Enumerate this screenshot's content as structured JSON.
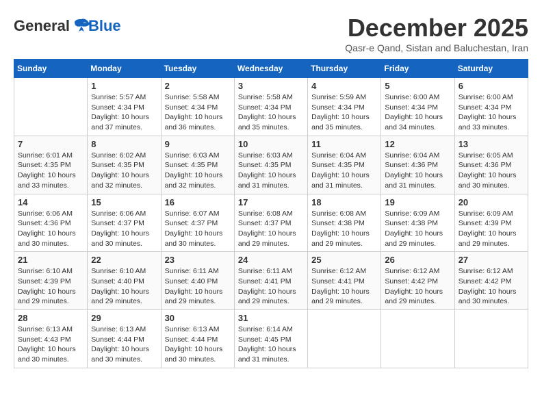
{
  "logo": {
    "general": "General",
    "blue": "Blue"
  },
  "header": {
    "title": "December 2025",
    "subtitle": "Qasr-e Qand, Sistan and Baluchestan, Iran"
  },
  "columns": [
    "Sunday",
    "Monday",
    "Tuesday",
    "Wednesday",
    "Thursday",
    "Friday",
    "Saturday"
  ],
  "weeks": [
    {
      "days": [
        {
          "num": "",
          "info": ""
        },
        {
          "num": "1",
          "info": "Sunrise: 5:57 AM\nSunset: 4:34 PM\nDaylight: 10 hours\nand 37 minutes."
        },
        {
          "num": "2",
          "info": "Sunrise: 5:58 AM\nSunset: 4:34 PM\nDaylight: 10 hours\nand 36 minutes."
        },
        {
          "num": "3",
          "info": "Sunrise: 5:58 AM\nSunset: 4:34 PM\nDaylight: 10 hours\nand 35 minutes."
        },
        {
          "num": "4",
          "info": "Sunrise: 5:59 AM\nSunset: 4:34 PM\nDaylight: 10 hours\nand 35 minutes."
        },
        {
          "num": "5",
          "info": "Sunrise: 6:00 AM\nSunset: 4:34 PM\nDaylight: 10 hours\nand 34 minutes."
        },
        {
          "num": "6",
          "info": "Sunrise: 6:00 AM\nSunset: 4:34 PM\nDaylight: 10 hours\nand 33 minutes."
        }
      ]
    },
    {
      "days": [
        {
          "num": "7",
          "info": "Sunrise: 6:01 AM\nSunset: 4:35 PM\nDaylight: 10 hours\nand 33 minutes."
        },
        {
          "num": "8",
          "info": "Sunrise: 6:02 AM\nSunset: 4:35 PM\nDaylight: 10 hours\nand 32 minutes."
        },
        {
          "num": "9",
          "info": "Sunrise: 6:03 AM\nSunset: 4:35 PM\nDaylight: 10 hours\nand 32 minutes."
        },
        {
          "num": "10",
          "info": "Sunrise: 6:03 AM\nSunset: 4:35 PM\nDaylight: 10 hours\nand 31 minutes."
        },
        {
          "num": "11",
          "info": "Sunrise: 6:04 AM\nSunset: 4:35 PM\nDaylight: 10 hours\nand 31 minutes."
        },
        {
          "num": "12",
          "info": "Sunrise: 6:04 AM\nSunset: 4:36 PM\nDaylight: 10 hours\nand 31 minutes."
        },
        {
          "num": "13",
          "info": "Sunrise: 6:05 AM\nSunset: 4:36 PM\nDaylight: 10 hours\nand 30 minutes."
        }
      ]
    },
    {
      "days": [
        {
          "num": "14",
          "info": "Sunrise: 6:06 AM\nSunset: 4:36 PM\nDaylight: 10 hours\nand 30 minutes."
        },
        {
          "num": "15",
          "info": "Sunrise: 6:06 AM\nSunset: 4:37 PM\nDaylight: 10 hours\nand 30 minutes."
        },
        {
          "num": "16",
          "info": "Sunrise: 6:07 AM\nSunset: 4:37 PM\nDaylight: 10 hours\nand 30 minutes."
        },
        {
          "num": "17",
          "info": "Sunrise: 6:08 AM\nSunset: 4:37 PM\nDaylight: 10 hours\nand 29 minutes."
        },
        {
          "num": "18",
          "info": "Sunrise: 6:08 AM\nSunset: 4:38 PM\nDaylight: 10 hours\nand 29 minutes."
        },
        {
          "num": "19",
          "info": "Sunrise: 6:09 AM\nSunset: 4:38 PM\nDaylight: 10 hours\nand 29 minutes."
        },
        {
          "num": "20",
          "info": "Sunrise: 6:09 AM\nSunset: 4:39 PM\nDaylight: 10 hours\nand 29 minutes."
        }
      ]
    },
    {
      "days": [
        {
          "num": "21",
          "info": "Sunrise: 6:10 AM\nSunset: 4:39 PM\nDaylight: 10 hours\nand 29 minutes."
        },
        {
          "num": "22",
          "info": "Sunrise: 6:10 AM\nSunset: 4:40 PM\nDaylight: 10 hours\nand 29 minutes."
        },
        {
          "num": "23",
          "info": "Sunrise: 6:11 AM\nSunset: 4:40 PM\nDaylight: 10 hours\nand 29 minutes."
        },
        {
          "num": "24",
          "info": "Sunrise: 6:11 AM\nSunset: 4:41 PM\nDaylight: 10 hours\nand 29 minutes."
        },
        {
          "num": "25",
          "info": "Sunrise: 6:12 AM\nSunset: 4:41 PM\nDaylight: 10 hours\nand 29 minutes."
        },
        {
          "num": "26",
          "info": "Sunrise: 6:12 AM\nSunset: 4:42 PM\nDaylight: 10 hours\nand 29 minutes."
        },
        {
          "num": "27",
          "info": "Sunrise: 6:12 AM\nSunset: 4:42 PM\nDaylight: 10 hours\nand 30 minutes."
        }
      ]
    },
    {
      "days": [
        {
          "num": "28",
          "info": "Sunrise: 6:13 AM\nSunset: 4:43 PM\nDaylight: 10 hours\nand 30 minutes."
        },
        {
          "num": "29",
          "info": "Sunrise: 6:13 AM\nSunset: 4:44 PM\nDaylight: 10 hours\nand 30 minutes."
        },
        {
          "num": "30",
          "info": "Sunrise: 6:13 AM\nSunset: 4:44 PM\nDaylight: 10 hours\nand 30 minutes."
        },
        {
          "num": "31",
          "info": "Sunrise: 6:14 AM\nSunset: 4:45 PM\nDaylight: 10 hours\nand 31 minutes."
        },
        {
          "num": "",
          "info": ""
        },
        {
          "num": "",
          "info": ""
        },
        {
          "num": "",
          "info": ""
        }
      ]
    }
  ]
}
